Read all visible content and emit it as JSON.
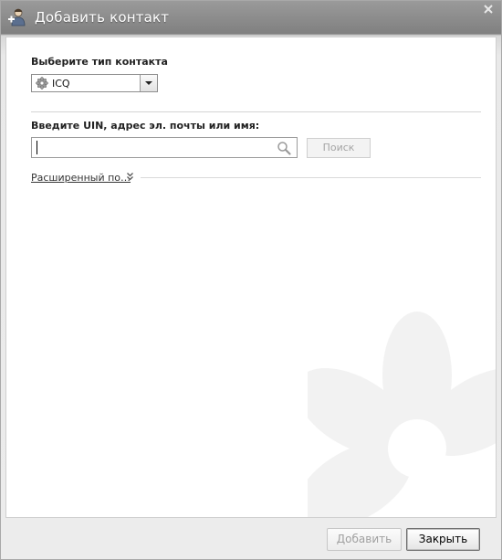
{
  "window": {
    "title": "Добавить контакт"
  },
  "contact_type": {
    "label": "Выберите тип контакта",
    "selected": "ICQ",
    "icon": "icq-flower-icon"
  },
  "search": {
    "label": "Введите UIN, адрес эл. почты или имя:",
    "value": "",
    "button_label": "Поиск"
  },
  "advanced": {
    "link_label": "Расширенный по…"
  },
  "footer": {
    "add_label": "Добавить",
    "close_label": "Закрыть"
  },
  "colors": {
    "titlebar": "#8a8a8a",
    "icq_green": "#7aa53a",
    "disabled_text": "#a0a0a0"
  }
}
